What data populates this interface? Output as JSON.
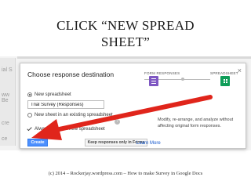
{
  "slide": {
    "title_line1": "CLICK “NEW SPREAD",
    "title_line2": "SHEET”",
    "footer": "(c) 2014 – Rockerjay.wordpress.com – How to make Survey in Google Docs"
  },
  "background": {
    "fragments": [
      "ial S",
      "ww Be",
      "cre",
      "ce"
    ]
  },
  "dialog": {
    "title": "Choose response destination",
    "close": "×",
    "options": [
      {
        "label": "New spreadsheet",
        "selected": true
      },
      {
        "label": "New sheet in an existing spreadsheet",
        "selected": false
      }
    ],
    "spreadsheet_name": "Trial Survey (Responses)",
    "always_create_label": "Always create a new spreadsheet",
    "help": "?",
    "flow": {
      "form_label": "FORM RESPONSES",
      "sheet_label": "SPREADSHEET"
    },
    "description": "Modify, re-arrange, and analyze without affecting original form responses.",
    "buttons": {
      "create": "Create",
      "keep": "Keep responses only in Forms",
      "learn_more": "Learn More"
    }
  },
  "colors": {
    "arrow": "#e0251b",
    "primary_button": "#4d90fe",
    "form_tile": "#7e57c2",
    "sheet_tile": "#0f9d58"
  }
}
